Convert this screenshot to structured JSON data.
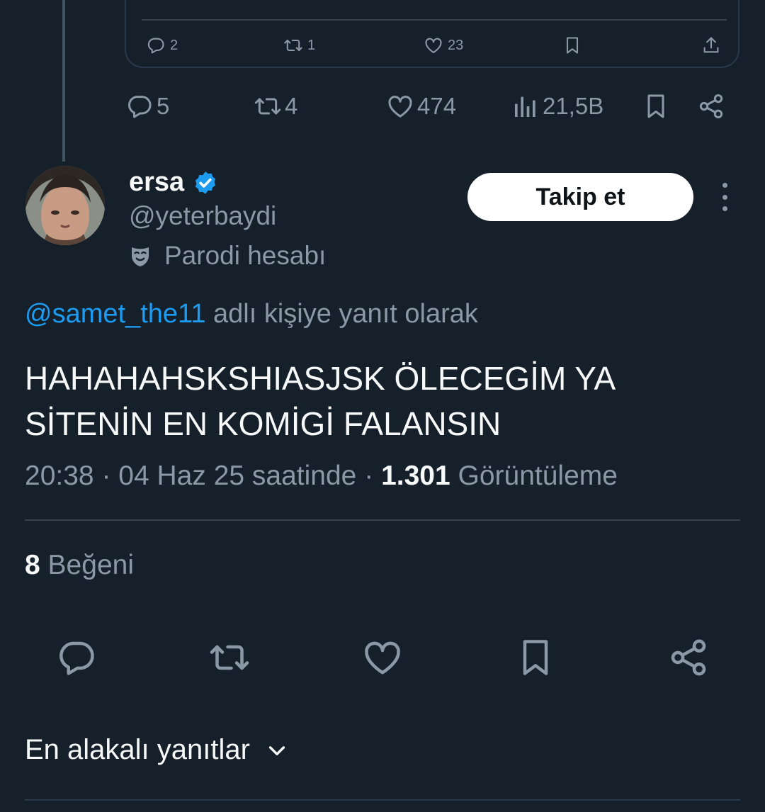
{
  "quoted_tweet": {
    "replies": "2",
    "retweets": "1",
    "likes": "23"
  },
  "parent_tweet": {
    "replies": "5",
    "retweets": "4",
    "likes": "474",
    "views": "21,5B"
  },
  "tweet": {
    "author_name": "ersa",
    "author_handle": "@yeterbaydi",
    "parody_label": "Parodi hesabı",
    "follow_label": "Takip et",
    "reply_mention": "@samet_the11",
    "reply_suffix": " adlı kişiye yanıt olarak",
    "text": "HAHAHAHSKSHIASJSK ÖLECEGİM YA SİTENİN EN KOMİGİ FALANSIN",
    "time": "20:38",
    "date": "04 Haz 25 saatinde",
    "separator": "·",
    "views_count": "1.301",
    "views_label": "Görüntüleme",
    "likes_count": "8",
    "likes_label": "Beğeni"
  },
  "replies_sort": {
    "label": "En alakalı yanıtlar"
  },
  "colors": {
    "background": "#15202b",
    "text_primary": "#f7f9f9",
    "text_secondary": "#8b98a5",
    "accent": "#1d9bf0",
    "divider": "#38444d"
  },
  "icons": [
    "reply-icon",
    "retweet-icon",
    "like-icon",
    "bookmark-icon",
    "share-icon",
    "upload-icon",
    "views-icon",
    "verified-badge-icon",
    "parody-mask-icon",
    "more-icon",
    "chevron-down-icon"
  ]
}
